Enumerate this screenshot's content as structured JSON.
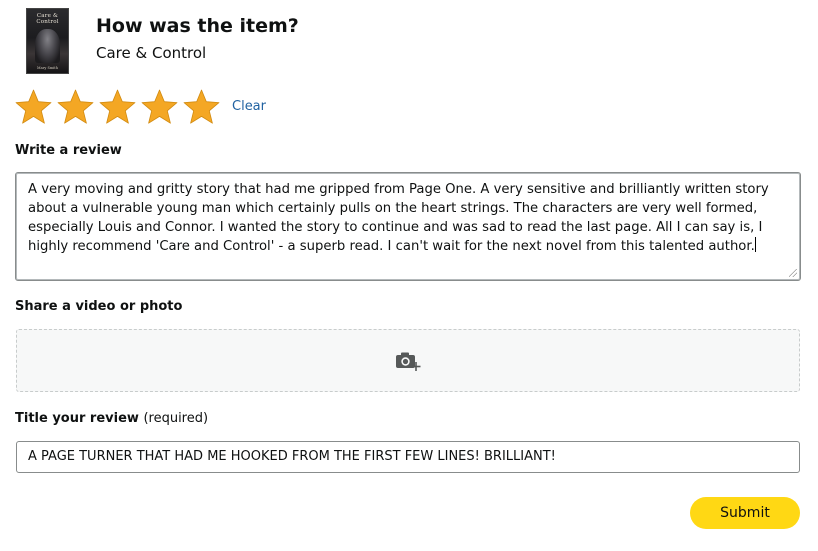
{
  "product": {
    "heading": "How was the item?",
    "name": "Care & Control",
    "thumbnail": {
      "title_line1": "Care &",
      "title_line2": "Control",
      "author": "Mary Smith"
    }
  },
  "rating": {
    "value": 5,
    "max": 5,
    "star_color": "#f4a724",
    "clear_label": "Clear"
  },
  "review": {
    "label": "Write a review",
    "text": "A very moving and gritty story that had me gripped from Page One. A very sensitive and brilliantly written story about a vulnerable young man which certainly pulls on the heart strings. The characters are very well formed, especially Louis and Connor. I wanted the story to continue and was sad to read the last page. All I can say is, I highly recommend 'Care and Control' - a superb read. I can't wait for the next novel from this talented author."
  },
  "media": {
    "label": "Share a video or photo",
    "icon": "camera-plus-icon"
  },
  "title": {
    "label": "Title your review",
    "required_note": "(required)",
    "value": "A PAGE TURNER THAT HAD ME HOOKED FROM THE FIRST FEW LINES! BRILLIANT!"
  },
  "submit_label": "Submit",
  "colors": {
    "accent_button": "#ffd814",
    "link": "#2162a1",
    "text": "#0f1111"
  }
}
